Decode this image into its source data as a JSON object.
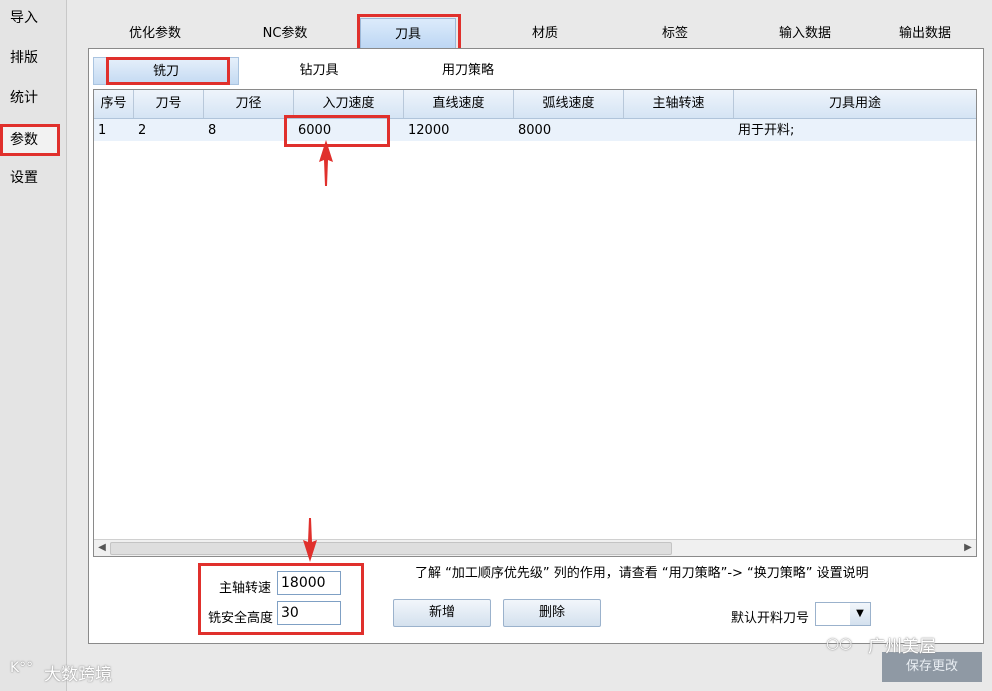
{
  "sidebar": {
    "items": [
      {
        "label": "导入"
      },
      {
        "label": "排版"
      },
      {
        "label": "统计"
      },
      {
        "label": "参数",
        "active": true
      },
      {
        "label": "设置"
      }
    ]
  },
  "top_tabs": [
    {
      "label": "优化参数"
    },
    {
      "label": "NC参数"
    },
    {
      "label": "刀具",
      "active": true
    },
    {
      "label": "材质"
    },
    {
      "label": "标签"
    },
    {
      "label": "输入数据"
    },
    {
      "label": "输出数据"
    }
  ],
  "sub_tabs": [
    {
      "label": "铣刀",
      "active": true
    },
    {
      "label": "钻刀具"
    },
    {
      "label": "用刀策略"
    }
  ],
  "table": {
    "columns": [
      "序号",
      "刀号",
      "刀径",
      "入刀速度",
      "直线速度",
      "弧线速度",
      "主轴转速",
      "刀具用途"
    ],
    "rows": [
      [
        "1",
        "2",
        "8",
        "6000",
        "12000",
        "8000",
        "",
        "用于开料;"
      ]
    ]
  },
  "form": {
    "spindle_label": "主轴转速",
    "spindle_value": "18000",
    "safe_height_label": "铣安全高度",
    "safe_height_value": "30",
    "note": "了解 “加工顺序优先级” 列的作用，请查看 “用刀策略”-> “换刀策略” 设置说明",
    "add_label": "新增",
    "delete_label": "删除",
    "default_tool_label": "默认开料刀号",
    "default_tool_value": ""
  },
  "save_label": "保存更改",
  "watermarks": {
    "left": "大数跨境",
    "right": "广州美屋"
  },
  "colors": {
    "highlight": "#e0302c",
    "header": "#d5e4f4"
  }
}
